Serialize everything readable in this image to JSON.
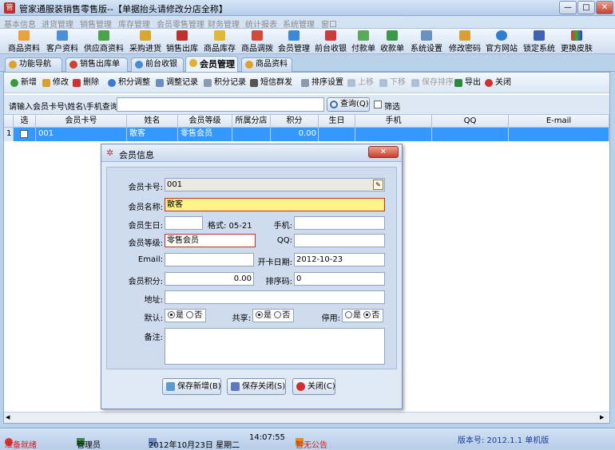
{
  "window": {
    "title": "管家通服装销售零售版--【单据抬头请修改分店全称】",
    "min": "—",
    "max": "□",
    "close": "✕"
  },
  "menu": [
    "基本信息",
    "进货管理",
    "销售管理",
    "库存管理",
    "会员零售管理",
    "财务管理",
    "统计报表",
    "系统管理",
    "窗口"
  ],
  "toolbar": [
    "商品资料",
    "客户资料",
    "供应商资料",
    "采购进货",
    "销售出库",
    "商品库存",
    "商品调拨",
    "会员管理",
    "前台收银",
    "付款单",
    "收款单",
    "系统设置",
    "修改密码",
    "官方网站",
    "锁定系统",
    "更换皮肤"
  ],
  "tabs": [
    "功能导航",
    "销售出库单",
    "前台收银",
    "会员管理",
    "商品资料"
  ],
  "actions": [
    "新增",
    "修改",
    "删除",
    "积分调整",
    "调整记录",
    "积分记录",
    "短信群发",
    "排序设置",
    "上移",
    "下移",
    "保存排序",
    "导出",
    "关闭"
  ],
  "search": {
    "label": "请输入会员卡号\\姓名\\手机查询:",
    "value": "",
    "button": "查询(Q)",
    "filter": "筛选"
  },
  "grid": {
    "columns": [
      "选",
      "会员卡号",
      "姓名",
      "会员等级",
      "所属分店",
      "积分",
      "生日",
      "手机",
      "QQ",
      "E-mail"
    ],
    "rows": [
      {
        "no": "1",
        "card": "001",
        "name": "散客",
        "level": "零售会员",
        "branch": "",
        "points": "0.00",
        "birthday": "",
        "phone": "",
        "qq": "",
        "email": ""
      }
    ]
  },
  "dialog": {
    "title": "会员信息",
    "labels": {
      "card": "会员卡号:",
      "name": "会员名称:",
      "birthday": "会员生日:",
      "format": "格式: 05-21",
      "phone": "手机:",
      "level": "会员等级:",
      "qq": "QQ:",
      "email": "Email:",
      "open_date": "开卡日期:",
      "points": "会员积分:",
      "sort": "排序码:",
      "address": "地址:",
      "default": "默认:",
      "share": "共享:",
      "disable": "停用:",
      "remark": "备注:"
    },
    "values": {
      "card": "001",
      "name": "散客",
      "birthday": "",
      "phone": "",
      "level": "零售会员",
      "qq": "",
      "email": "",
      "open_date": "2012-10-23",
      "points": "0.00",
      "sort": "0",
      "address": "",
      "remark": ""
    },
    "yes": "是",
    "no": "否",
    "radios": {
      "default": "yes",
      "share": "yes",
      "disable": "no"
    },
    "buttons": {
      "save_new": "保存新增(B)",
      "save_close": "保存关闭(S)",
      "close": "关闭(C)"
    }
  },
  "status": {
    "ready": "准备就绪",
    "user": "管理员",
    "date": "2012年10月23日 星期二",
    "time": "14:07:55",
    "notice": "暂无公告",
    "version": "版本号: 2012.1.1 单机版"
  }
}
